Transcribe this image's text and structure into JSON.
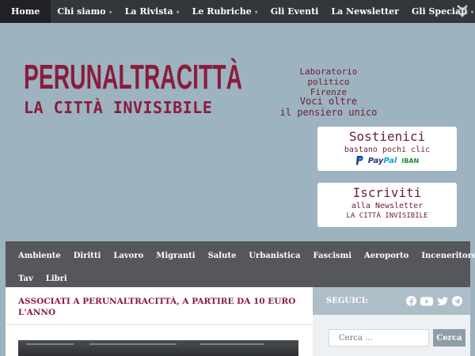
{
  "topnav": {
    "items": [
      {
        "label": "Home",
        "dropdown": false
      },
      {
        "label": "Chi siamo",
        "dropdown": true
      },
      {
        "label": "La Rivista",
        "dropdown": true
      },
      {
        "label": "Le Rubriche",
        "dropdown": true
      },
      {
        "label": "Gli Eventi",
        "dropdown": false
      },
      {
        "label": "La Newsletter",
        "dropdown": false
      },
      {
        "label": "Gli Speciali",
        "dropdown": true
      }
    ],
    "caret": "▾",
    "menu_icon": "double-chevron-down-icon"
  },
  "header": {
    "logo_line1": "PERUNALTRACITTÀ",
    "logo_line2": "LA CITTÀ INVISIBILE",
    "tagline_1": "Laboratorio politico",
    "tagline_2": "Firenze",
    "tagline_3": "Voci oltre",
    "tagline_4": "il pensiero unico",
    "brand_color": "#8a1c3c"
  },
  "cta_support": {
    "title": "Sostienici",
    "subtitle": "bastano pochi clic",
    "paypal_pay": "Pay",
    "paypal_pal": "Pal",
    "iban": "IBAN"
  },
  "cta_subscribe": {
    "title": "Iscriviti",
    "subtitle": "alla Newsletter",
    "subtitle2": "LA CITTÀ INVISIBILE"
  },
  "categories": {
    "row1": [
      "Ambiente",
      "Diritti",
      "Lavoro",
      "Migranti",
      "Salute",
      "Urbanistica",
      "Fascismi",
      "Aeroporto",
      "Inceneritore"
    ],
    "row2": [
      "Tav",
      "Libri"
    ]
  },
  "main": {
    "post_title": "ASSOCIATI A PERUNALTRACITTÀ, A PARTIRE DA 10 EURO L'ANNO"
  },
  "sidebar": {
    "follow_label": "SEGUICI:",
    "social_icons": [
      "facebook-icon",
      "youtube-icon",
      "twitter-icon",
      "telegram-icon"
    ],
    "search_placeholder": "Cerca ...",
    "search_button": "Cerca"
  }
}
